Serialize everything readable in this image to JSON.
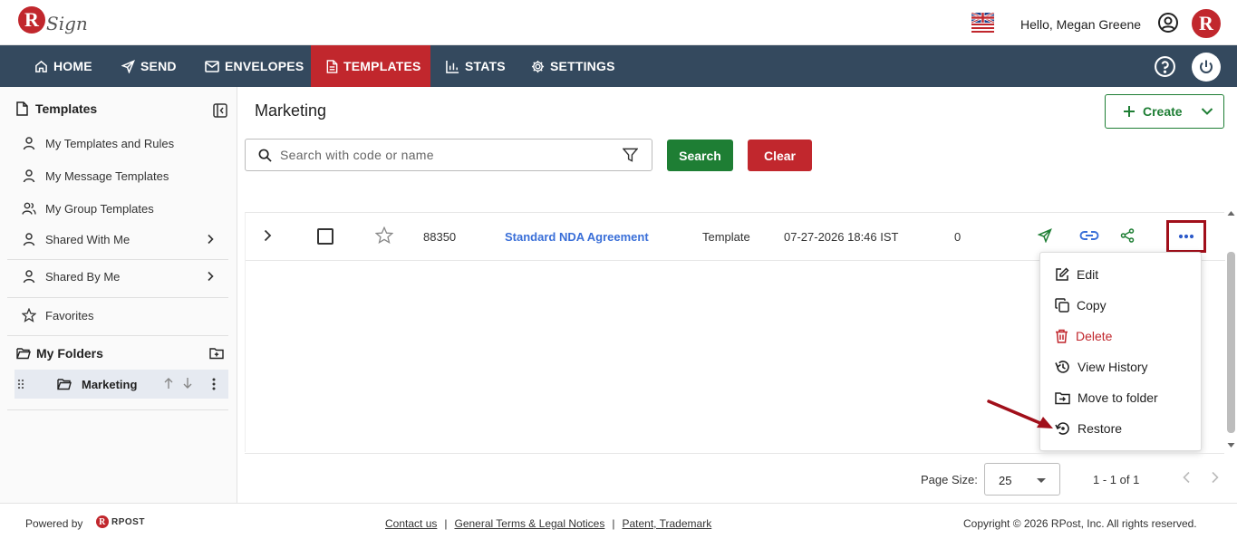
{
  "brand": {
    "logo_letter": "R",
    "logo_word": "Sign"
  },
  "header": {
    "greeting": "Hello, Megan Greene",
    "avatar_letter": "R"
  },
  "nav": {
    "items": [
      {
        "label": "HOME",
        "icon": "home-icon"
      },
      {
        "label": "SEND",
        "icon": "send-icon"
      },
      {
        "label": "ENVELOPES",
        "icon": "envelope-icon"
      },
      {
        "label": "TEMPLATES",
        "icon": "document-icon",
        "active": true
      },
      {
        "label": "STATS",
        "icon": "bar-chart-icon"
      },
      {
        "label": "SETTINGS",
        "icon": "gear-icon"
      }
    ]
  },
  "sidebar": {
    "title": "Templates",
    "items": [
      {
        "label": "My Templates and Rules",
        "icon": "user-icon"
      },
      {
        "label": "My Message Templates",
        "icon": "user-icon"
      },
      {
        "label": "My Group Templates",
        "icon": "users-icon"
      },
      {
        "label": "Shared With Me",
        "icon": "user-icon"
      },
      {
        "label": "Shared By Me",
        "icon": "user-icon"
      },
      {
        "label": "Favorites",
        "icon": "star-icon"
      }
    ],
    "folders_title": "My Folders",
    "folders": [
      {
        "label": "Marketing"
      }
    ]
  },
  "main": {
    "title": "Marketing",
    "create_label": "Create",
    "search": {
      "placeholder": "Search with code or name",
      "value": ""
    },
    "search_label": "Search",
    "clear_label": "Clear"
  },
  "table": {
    "rows": [
      {
        "code": "88350",
        "name": "Standard NDA Agreement",
        "type": "Template",
        "date": "07-27-2026 18:46 IST",
        "count": "0"
      }
    ]
  },
  "menu": {
    "items": [
      {
        "label": "Edit",
        "icon": "edit-icon"
      },
      {
        "label": "Copy",
        "icon": "copy-icon"
      },
      {
        "label": "Delete",
        "icon": "trash-icon",
        "danger": true
      },
      {
        "label": "View History",
        "icon": "history-icon"
      },
      {
        "label": "Move to folder",
        "icon": "folder-move-icon"
      },
      {
        "label": "Restore",
        "icon": "restore-icon"
      }
    ]
  },
  "pager": {
    "page_size_label": "Page Size:",
    "page_size": "25",
    "range": "1 - 1 of 1"
  },
  "footer": {
    "powered_by": "Powered by",
    "rpost_letter": "R",
    "rpost_word": "RPOST",
    "links": [
      "Contact us",
      "General Terms & Legal Notices",
      "Patent, Trademark"
    ],
    "copyright": "Copyright © 2026 RPost, Inc. All rights reserved."
  },
  "colors": {
    "brand_red": "#c1272d",
    "nav_bg": "#34495e",
    "green": "#1e7e34",
    "link_blue": "#3a6fd8"
  }
}
